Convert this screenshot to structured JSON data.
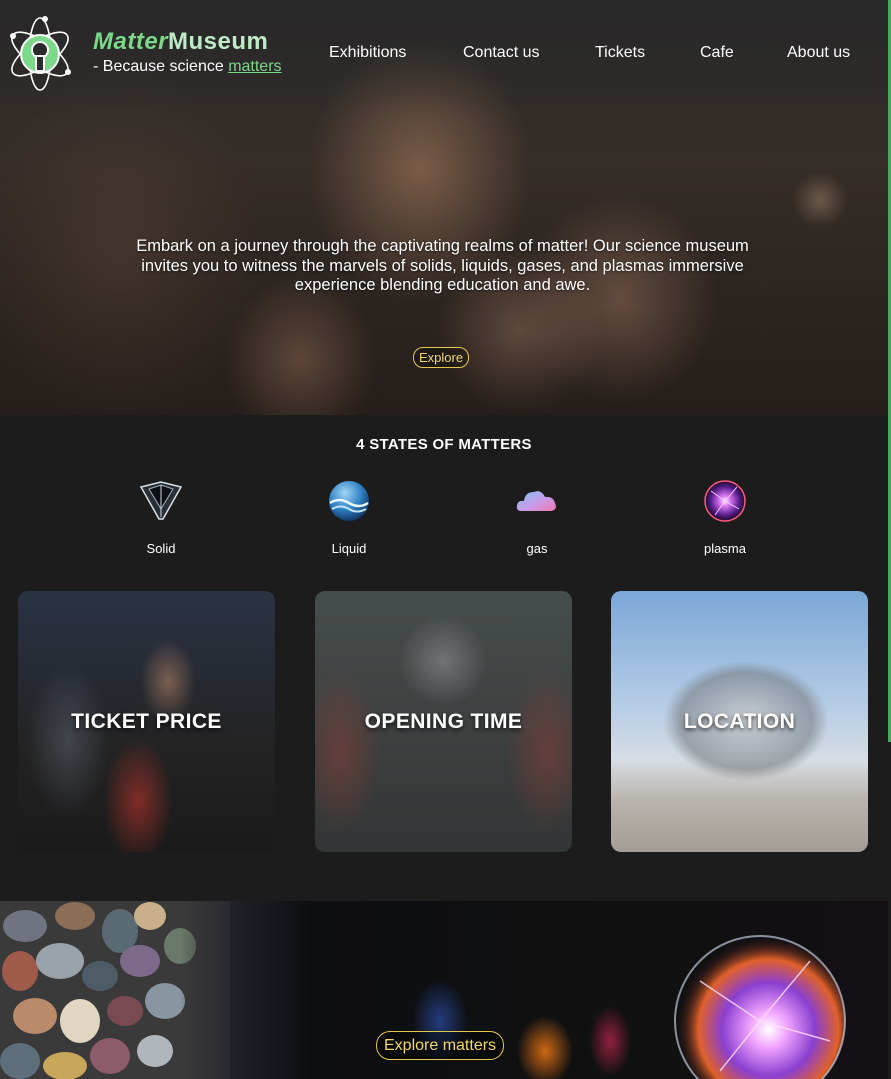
{
  "brand": {
    "name_part1": "Matter",
    "name_part2": "Museum",
    "tagline_prefix": "- Because science ",
    "tagline_link": "matters"
  },
  "nav": {
    "items": [
      "Exhibitions",
      "Contact us",
      "Tickets",
      "Cafe",
      "About us"
    ]
  },
  "hero": {
    "description": "Embark on a journey through the captivating realms of matter! Our science museum invites you to witness the marvels of solids, liquids, gases, and plasmas immersive experience blending education and awe.",
    "explore_label": "Explore"
  },
  "states": {
    "title": "4 STATES OF MATTERS",
    "items": [
      {
        "label": "Solid",
        "icon": "solid-crystal-icon"
      },
      {
        "label": "Liquid",
        "icon": "liquid-wave-icon"
      },
      {
        "label": "gas",
        "icon": "gas-cloud-icon"
      },
      {
        "label": "plasma",
        "icon": "plasma-ball-icon"
      }
    ]
  },
  "cards": [
    {
      "label": "TICKET PRICE"
    },
    {
      "label": "OPENING TIME"
    },
    {
      "label": "LOCATION"
    }
  ],
  "banner": {
    "button_label": "Explore matters"
  },
  "colors": {
    "brand_green": "#7cd98a",
    "accent_yellow": "#e6c84a",
    "background": "#1c1c1c"
  }
}
